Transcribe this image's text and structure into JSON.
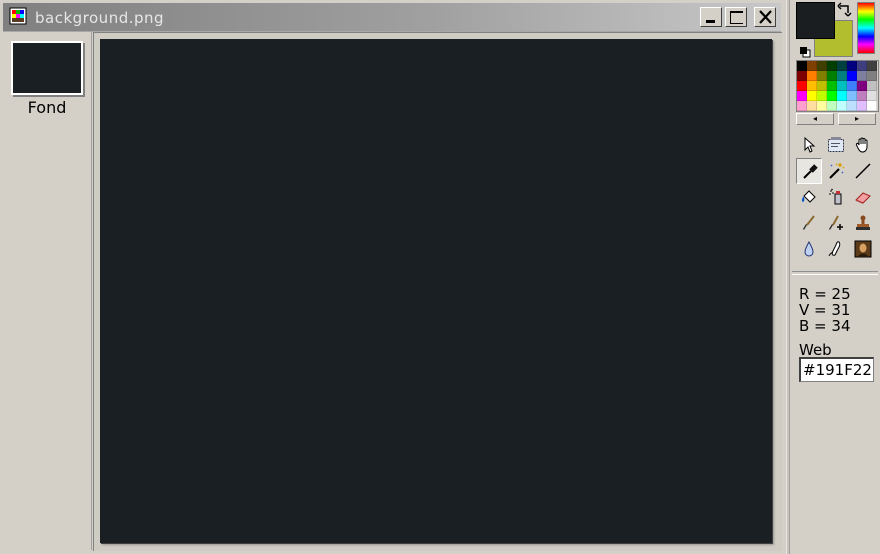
{
  "document": {
    "title": "background.png",
    "layer": {
      "label": "Fond"
    },
    "canvas_color": "#191F22"
  },
  "palette": {
    "foreground_color": "#1A1E21",
    "background_color": "#B3BE2E",
    "colors": [
      "#000000",
      "#7f3f00",
      "#3f3f00",
      "#003f00",
      "#003f3f",
      "#00007f",
      "#3f3f7f",
      "#404040",
      "#7f0000",
      "#ff7f00",
      "#7f7f00",
      "#007f00",
      "#007f7f",
      "#0000ff",
      "#7f7f9f",
      "#808080",
      "#ff0000",
      "#ffbf00",
      "#bfbf00",
      "#00bf00",
      "#00bfbf",
      "#3f7fff",
      "#7f007f",
      "#c0c0c0",
      "#ff00ff",
      "#ffff00",
      "#bfff00",
      "#00ff00",
      "#00ffff",
      "#7fbfff",
      "#bf7fbf",
      "#e0e0e0",
      "#ff9fcf",
      "#ffdf9f",
      "#ffff9f",
      "#bfffbf",
      "#bfffff",
      "#bfdfff",
      "#dfbfff",
      "#ffffff"
    ],
    "scroll_left": "◂",
    "scroll_right": "▸"
  },
  "tools": [
    {
      "name": "select-arrow"
    },
    {
      "name": "rect-select"
    },
    {
      "name": "hand"
    },
    {
      "name": "color-picker"
    },
    {
      "name": "magic-wand"
    },
    {
      "name": "line"
    },
    {
      "name": "paint-bucket"
    },
    {
      "name": "spray"
    },
    {
      "name": "eraser"
    },
    {
      "name": "brush"
    },
    {
      "name": "brush-plus"
    },
    {
      "name": "stamp"
    },
    {
      "name": "drop"
    },
    {
      "name": "smudge"
    },
    {
      "name": "portrait"
    }
  ],
  "color_info": {
    "r": "R = 25",
    "v": "V = 31",
    "b": "B = 34",
    "web_label": "Web",
    "web_value": "#191F22"
  }
}
